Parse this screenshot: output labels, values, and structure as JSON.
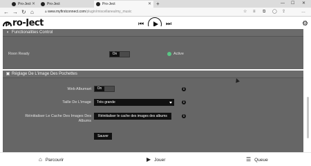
{
  "browser": {
    "tabs": [
      {
        "label": "Pro-Ject"
      },
      {
        "label": "Pro-Ject"
      },
      {
        "label": "Pro-Ject"
      }
    ],
    "new_tab": "+",
    "window_controls": {
      "minimize": "—",
      "maximize": "☐",
      "close": "✕"
    },
    "url_host": "www.myfirstconnect.com",
    "url_path": "/plugin/miscellanea/my_music"
  },
  "app": {
    "logo_letter": "P",
    "logo_text": "ro-Ject",
    "bottom_nav": [
      {
        "icon": "home-icon",
        "label": "Parcourir"
      },
      {
        "icon": "play-icon",
        "label": "Jouer"
      },
      {
        "icon": "queue-icon",
        "label": "Queue"
      }
    ]
  },
  "functionalities": {
    "title": "Functionalities Control",
    "room_ready_label": "Roon Ready",
    "toggle_label": "On",
    "status_label": "Active",
    "status_color": "#59c785"
  },
  "cover_settings": {
    "title": "Réglage De L'image Des Pochettes",
    "web_albumart_label": "Web Albumart",
    "web_albumart_value": "On",
    "size_label": "Taille De L'image",
    "size_value": "Très grande",
    "reset_label_line1": "Réinitialiser Le Cache Des Images Des",
    "reset_label_line2": "Albums",
    "reset_button": "Réinitialiser le cache des images des albums",
    "save_button": "Sauver"
  },
  "colors": {
    "panel": "#666666",
    "dark": "#111111",
    "accent": "#59c785"
  }
}
